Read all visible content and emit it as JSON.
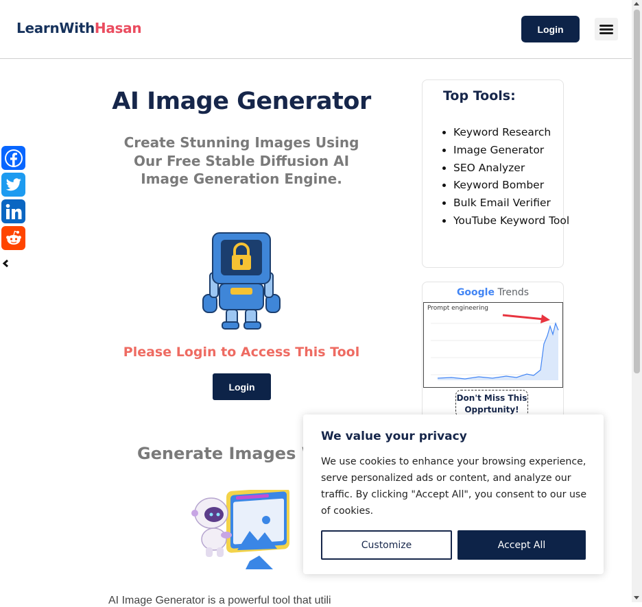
{
  "header": {
    "logo_part1": "LearnWith",
    "logo_part2": "Hasan",
    "login_label": "Login",
    "menu_icon": "hamburger-menu-icon"
  },
  "share_bar": {
    "items": [
      {
        "name": "Facebook",
        "icon": "facebook-icon",
        "color": "#0866ff"
      },
      {
        "name": "Twitter",
        "icon": "twitter-icon",
        "color": "#1d9bf0"
      },
      {
        "name": "LinkedIn",
        "icon": "linkedin-icon",
        "color": "#0a66c2"
      },
      {
        "name": "Reddit",
        "icon": "reddit-icon",
        "color": "#ff4500"
      }
    ],
    "hide_icon": "hide-chevron-icon"
  },
  "main": {
    "title": "AI Image Generator",
    "subtitle": "Create Stunning Images Using Our Free Stable Diffusion AI Image Generation Engine.",
    "login_message": "Please Login to Access This Tool",
    "login_label": "Login",
    "section_heading": "Generate Images W",
    "body_text": "AI Image Generator is a powerful tool that utili"
  },
  "sidebar": {
    "tools_title": "Top Tools:",
    "tools": [
      "Keyword Research",
      "Image Generator",
      "SEO Analyzer",
      "Keyword Bomber",
      "Bulk Email Verifier",
      "YouTube Keyword Tool"
    ],
    "trends": {
      "logo_google": "Google",
      "logo_trends": "Trends",
      "chart_label": "Prompt engineering",
      "cta": "Don't Miss This Opprtunity!"
    }
  },
  "cookie_banner": {
    "title": "We value your privacy",
    "text": "We use cookies to enhance your browsing experience, serve personalized ads or content, and analyze our traffic. By clicking \"Accept All\", you consent to our use of cookies.",
    "customize_label": "Customize",
    "accept_label": "Accept All"
  },
  "colors": {
    "brand_navy": "#0d2348",
    "brand_red": "#ea4c5f",
    "login_message": "#ee6b62"
  }
}
